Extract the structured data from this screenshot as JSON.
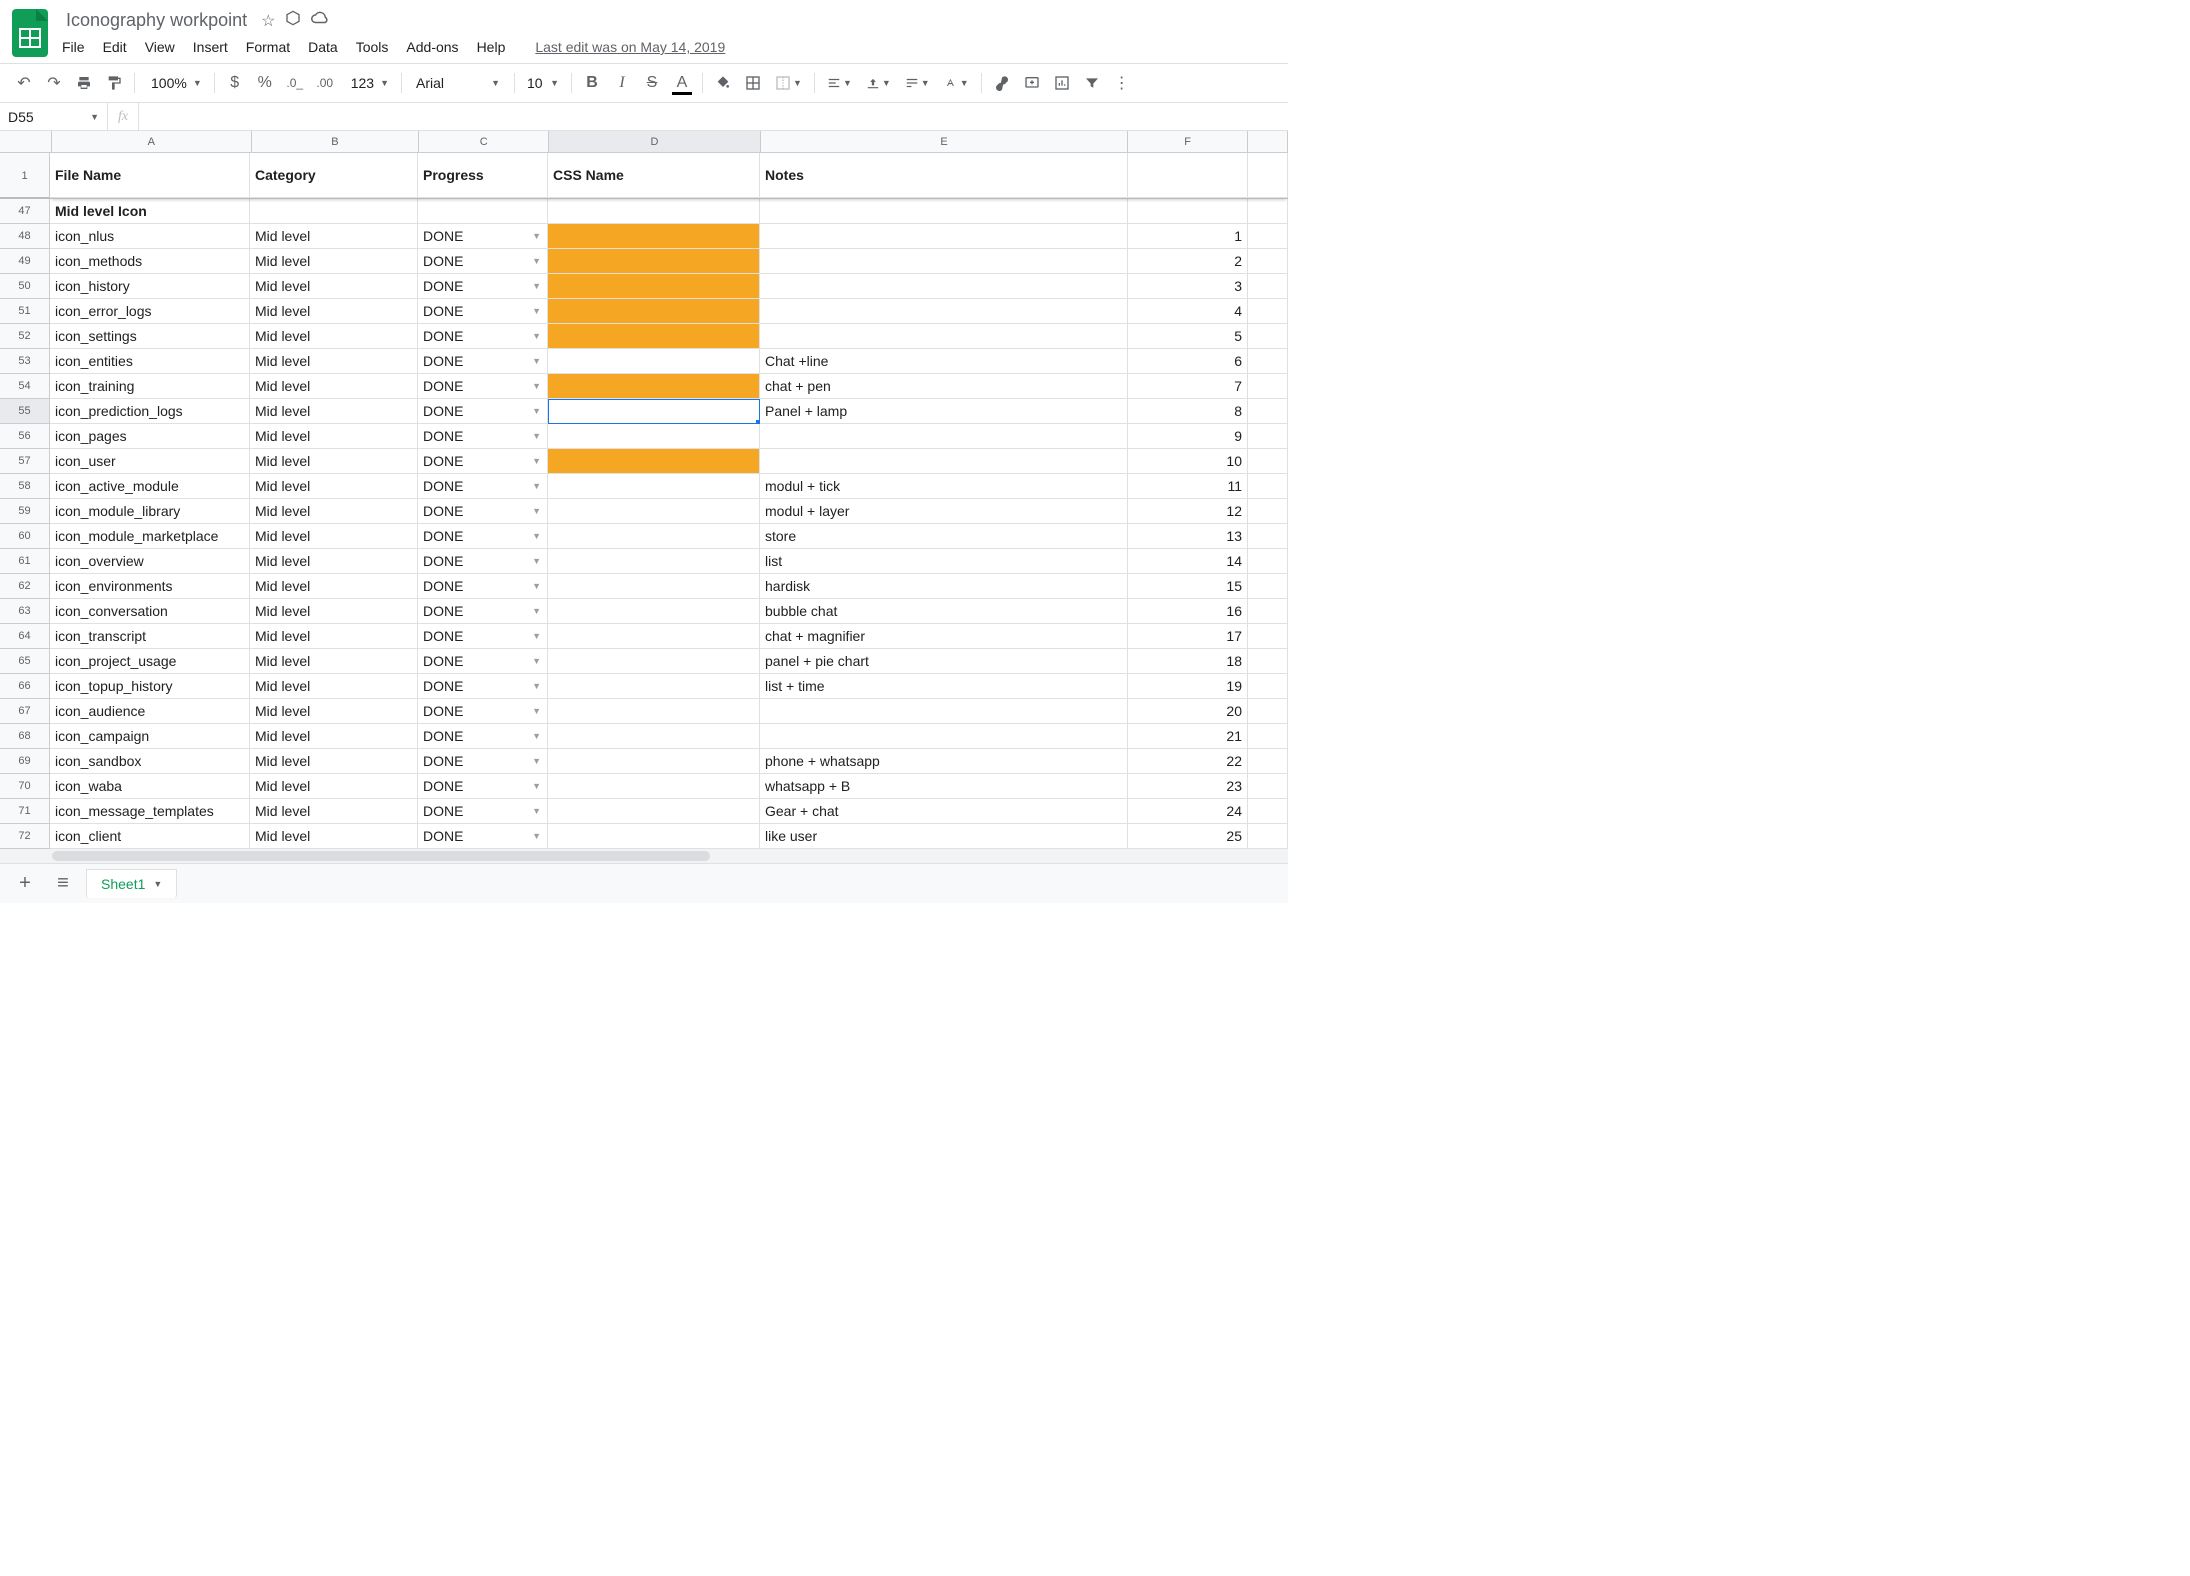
{
  "doc": {
    "title": "Iconography workpoint",
    "last_edit": "Last edit was on May 14, 2019"
  },
  "menu": [
    "File",
    "Edit",
    "View",
    "Insert",
    "Format",
    "Data",
    "Tools",
    "Add-ons",
    "Help"
  ],
  "toolbar": {
    "zoom": "100%",
    "num_label": "123",
    "font": "Arial",
    "font_size": "10"
  },
  "name_box": "D55",
  "fx_label": "fx",
  "selected": {
    "row": 55,
    "col": "D"
  },
  "columns": [
    {
      "id": "A",
      "label": "A",
      "w": "cA"
    },
    {
      "id": "B",
      "label": "B",
      "w": "cB"
    },
    {
      "id": "C",
      "label": "C",
      "w": "cC"
    },
    {
      "id": "D",
      "label": "D",
      "w": "cD"
    },
    {
      "id": "E",
      "label": "E",
      "w": "cE"
    },
    {
      "id": "F",
      "label": "F",
      "w": "cF"
    },
    {
      "id": "G",
      "label": "",
      "w": "cG"
    }
  ],
  "header_row_num": "1",
  "headers": {
    "A": "File Name",
    "B": "Category",
    "C": "Progress",
    "D": "CSS Name",
    "E": "Notes",
    "F": "",
    "G": ""
  },
  "section_row": {
    "num": "47",
    "A": "Mid level Icon"
  },
  "rows": [
    {
      "num": "48",
      "A": "icon_nlus",
      "B": "Mid level",
      "C": "DONE",
      "D": "",
      "D_orange": true,
      "E": "",
      "F": "1"
    },
    {
      "num": "49",
      "A": "icon_methods",
      "B": "Mid level",
      "C": "DONE",
      "D": "",
      "D_orange": true,
      "E": "",
      "F": "2"
    },
    {
      "num": "50",
      "A": "icon_history",
      "B": "Mid level",
      "C": "DONE",
      "D": "",
      "D_orange": true,
      "E": "",
      "F": "3"
    },
    {
      "num": "51",
      "A": "icon_error_logs",
      "B": "Mid level",
      "C": "DONE",
      "D": "",
      "D_orange": true,
      "E": "",
      "F": "4"
    },
    {
      "num": "52",
      "A": "icon_settings",
      "B": "Mid level",
      "C": "DONE",
      "D": "",
      "D_orange": true,
      "E": "",
      "F": "5"
    },
    {
      "num": "53",
      "A": "icon_entities",
      "B": "Mid level",
      "C": "DONE",
      "D": "",
      "D_orange": false,
      "E": "Chat +line",
      "F": "6"
    },
    {
      "num": "54",
      "A": "icon_training",
      "B": "Mid level",
      "C": "DONE",
      "D": "",
      "D_orange": true,
      "E": "chat + pen",
      "F": "7"
    },
    {
      "num": "55",
      "A": "icon_prediction_logs",
      "B": "Mid level",
      "C": "DONE",
      "D": "",
      "D_orange": false,
      "E": "Panel + lamp",
      "F": "8"
    },
    {
      "num": "56",
      "A": "icon_pages",
      "B": "Mid level",
      "C": "DONE",
      "D": "",
      "D_orange": false,
      "E": "",
      "F": "9"
    },
    {
      "num": "57",
      "A": "icon_user",
      "B": "Mid level",
      "C": "DONE",
      "D": "",
      "D_orange": true,
      "E": "",
      "F": "10"
    },
    {
      "num": "58",
      "A": "icon_active_module",
      "B": "Mid level",
      "C": "DONE",
      "D": "",
      "D_orange": false,
      "E": "modul + tick",
      "F": "11"
    },
    {
      "num": "59",
      "A": "icon_module_library",
      "B": "Mid level",
      "C": "DONE",
      "D": "",
      "D_orange": false,
      "E": "modul + layer",
      "F": "12"
    },
    {
      "num": "60",
      "A": "icon_module_marketplace",
      "B": "Mid level",
      "C": "DONE",
      "D": "",
      "D_orange": false,
      "E": "store",
      "F": "13"
    },
    {
      "num": "61",
      "A": "icon_overview",
      "B": "Mid level",
      "C": "DONE",
      "D": "",
      "D_orange": false,
      "E": "list",
      "F": "14"
    },
    {
      "num": "62",
      "A": "icon_environments",
      "B": "Mid level",
      "C": "DONE",
      "D": "",
      "D_orange": false,
      "E": "hardisk",
      "F": "15"
    },
    {
      "num": "63",
      "A": "icon_conversation",
      "B": "Mid level",
      "C": "DONE",
      "D": "",
      "D_orange": false,
      "E": "bubble chat",
      "F": "16"
    },
    {
      "num": "64",
      "A": "icon_transcript",
      "B": "Mid level",
      "C": "DONE",
      "D": "",
      "D_orange": false,
      "E": "chat + magnifier",
      "F": "17"
    },
    {
      "num": "65",
      "A": "icon_project_usage",
      "B": "Mid level",
      "C": "DONE",
      "D": "",
      "D_orange": false,
      "E": "panel + pie chart",
      "F": "18"
    },
    {
      "num": "66",
      "A": "icon_topup_history",
      "B": "Mid level",
      "C": "DONE",
      "D": "",
      "D_orange": false,
      "E": "list + time",
      "F": "19"
    },
    {
      "num": "67",
      "A": "icon_audience",
      "B": "Mid level",
      "C": "DONE",
      "D": "",
      "D_orange": false,
      "E": "",
      "F": "20"
    },
    {
      "num": "68",
      "A": "icon_campaign",
      "B": "Mid level",
      "C": "DONE",
      "D": "",
      "D_orange": false,
      "E": "",
      "F": "21"
    },
    {
      "num": "69",
      "A": "icon_sandbox",
      "B": "Mid level",
      "C": "DONE",
      "D": "",
      "D_orange": false,
      "E": "phone + whatsapp",
      "F": "22"
    },
    {
      "num": "70",
      "A": "icon_waba",
      "B": "Mid level",
      "C": "DONE",
      "D": "",
      "D_orange": false,
      "E": "whatsapp + B",
      "F": "23"
    },
    {
      "num": "71",
      "A": "icon_message_templates",
      "B": "Mid level",
      "C": "DONE",
      "D": "",
      "D_orange": false,
      "E": "Gear  + chat",
      "F": "24"
    },
    {
      "num": "72",
      "A": "icon_client",
      "B": "Mid level",
      "C": "DONE",
      "D": "",
      "D_orange": false,
      "E": "like user",
      "F": "25"
    }
  ],
  "sheet_tab": "Sheet1"
}
